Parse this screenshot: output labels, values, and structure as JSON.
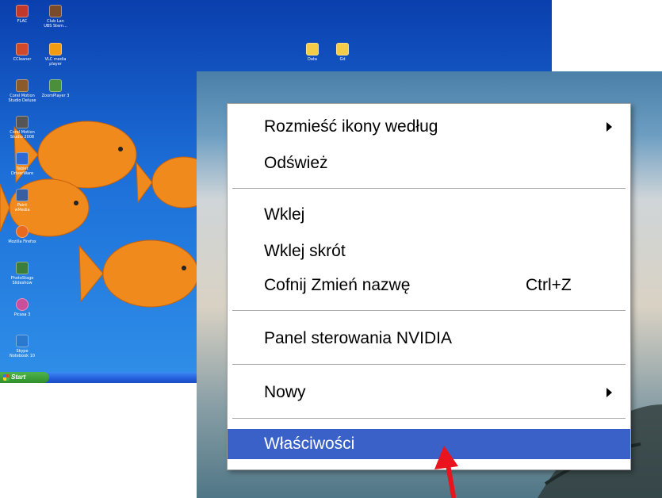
{
  "desktop": {
    "icons": [
      {
        "label": "FLAC",
        "color": "#c0392b"
      },
      {
        "label": "Club Lan\nUBS Stem...",
        "color": "#7a4b2a"
      },
      {
        "label": "CCleaner",
        "color": "#d04a2a"
      },
      {
        "label": "VLC media\nplayer",
        "color": "#f39c12"
      },
      {
        "label": "Corel Motion\nStudio Deluxe",
        "color": "#8b5a2b"
      },
      {
        "label": "ZoomPlayer 3",
        "color": "#4a8f3a"
      },
      {
        "label": "Corel Motion\nStudio 2008",
        "color": "#555555"
      },
      {
        "label": "Tablet\nDriverWare",
        "color": "#2d6ad6"
      },
      {
        "label": "Paint\nwMedia",
        "color": "#3a5fa0"
      },
      {
        "label": "Mozilla Firefox",
        "color": "#e86a1f"
      },
      {
        "label": "PhotoStage\nSlideshow",
        "color": "#3c7d3c"
      },
      {
        "label": "Picasa 3",
        "color": "#c94f9c"
      },
      {
        "label": "Skype\nNotebook 10",
        "color": "#2a79d0"
      }
    ],
    "folders": [
      {
        "label": "Data"
      },
      {
        "label": "Gd"
      }
    ],
    "taskbar": {
      "start_label": "Start"
    }
  },
  "menu": {
    "items": [
      {
        "label": "Rozmieść ikony według",
        "submenu": true
      },
      {
        "label": "Odśwież"
      },
      {
        "label": "Wklej"
      },
      {
        "label": "Wklej skrót"
      },
      {
        "label": "Cofnij Zmień nazwę",
        "shortcut": "Ctrl+Z"
      },
      {
        "label": "Panel sterowania NVIDIA"
      },
      {
        "label": "Nowy",
        "submenu": true
      },
      {
        "label": "Właściwości",
        "selected": true
      }
    ]
  },
  "colors": {
    "selection": "#3a61c8",
    "annotation_arrow": "#e8141e"
  }
}
